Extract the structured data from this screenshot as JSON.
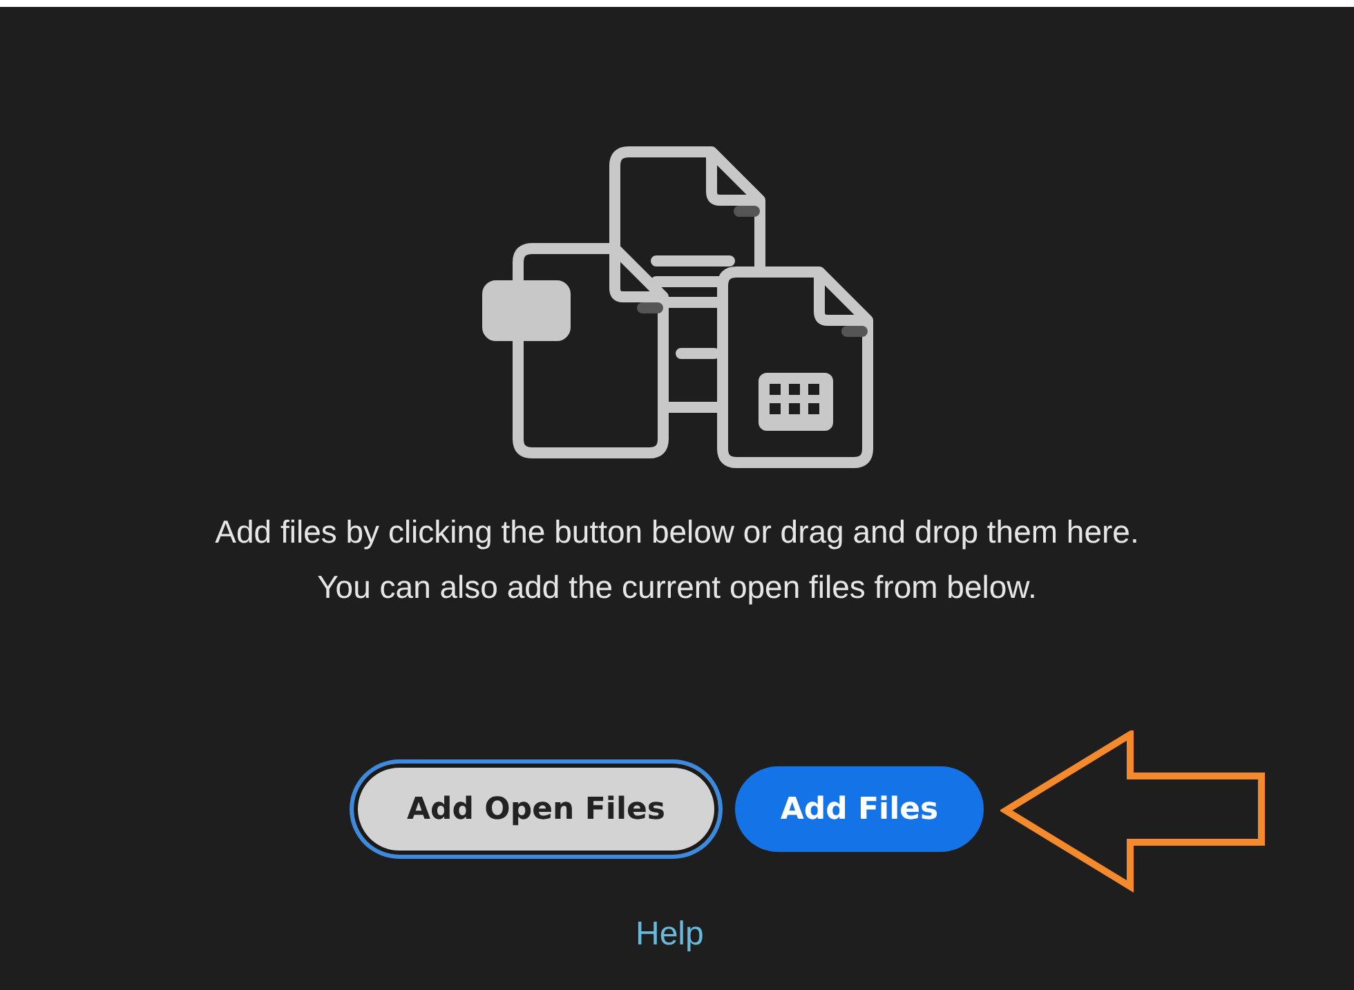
{
  "message": {
    "lines": [
      "Add files by clicking the button below or drag and drop them here.",
      "You can also add the current open files from below."
    ]
  },
  "buttons": [
    {
      "label": "Add Open Files",
      "kind": "secondary",
      "focused": true
    },
    {
      "label": "Add Files",
      "kind": "primary",
      "focused": false
    }
  ],
  "help_link": "Help"
}
